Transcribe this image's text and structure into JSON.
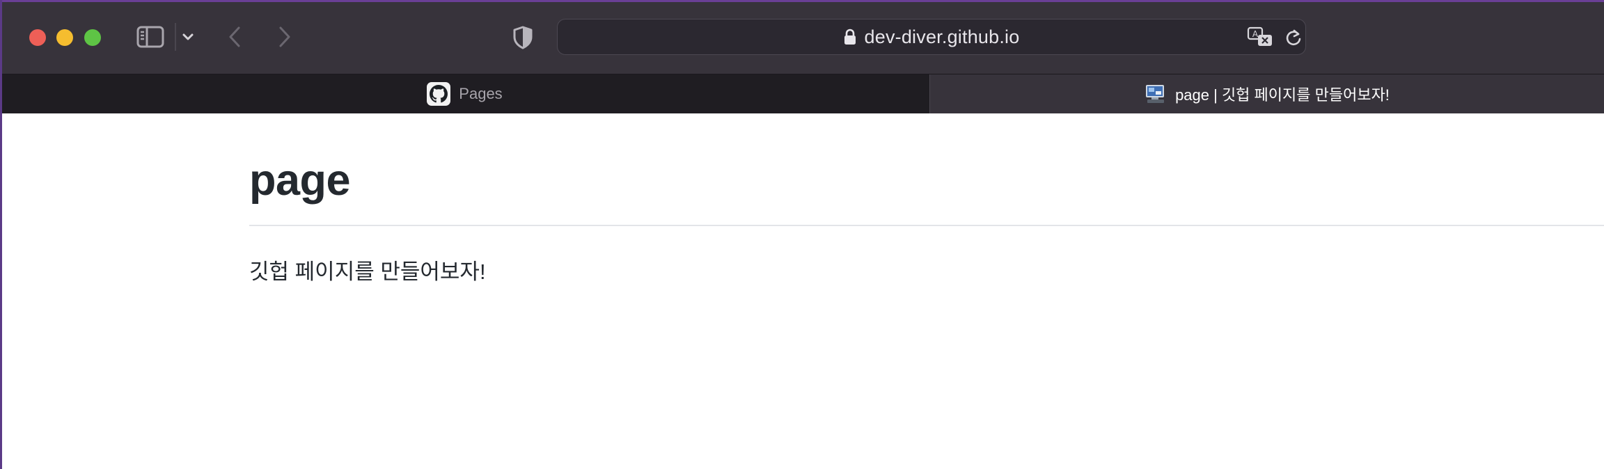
{
  "browser": {
    "url": "dev-diver.github.io",
    "colors": {
      "toolbar_bg": "#37333b",
      "inactive_tab_bg": "#1f1d22",
      "close": "#ee5f57",
      "minimize": "#f5bd2f",
      "maximize": "#5ec445"
    },
    "icons": {
      "sidebar": "sidebar-icon",
      "sidebar_menu": "chevron-down-icon",
      "back": "chevron-left-icon",
      "forward": "chevron-right-icon",
      "privacy": "shield-icon",
      "secure": "lock-icon",
      "translate": "translate-icon",
      "reload": "reload-icon"
    }
  },
  "tabs": [
    {
      "label": "Pages",
      "favicon": "github-icon",
      "active": false
    },
    {
      "label": "page | 깃헙 페이지를 만들어보자!",
      "favicon": "computer-icon",
      "active": true
    }
  ],
  "page": {
    "title": "page",
    "text": "깃헙 페이지를 만들어보자!"
  }
}
